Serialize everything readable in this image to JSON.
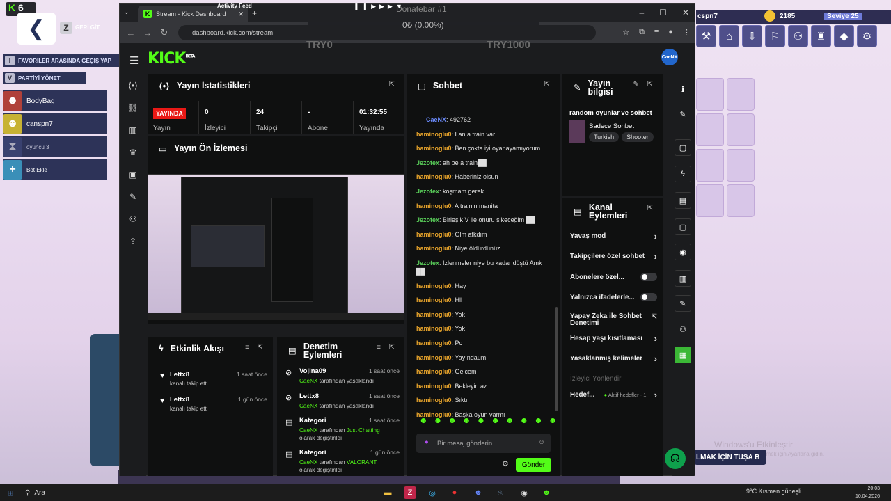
{
  "game": {
    "hud_count": "6",
    "back_label": "GERİ GİT",
    "back_key": "Z",
    "favorites_label": "FAVORİLER ARASINDA GEÇİŞ YAP",
    "favorites_key": "I",
    "party_label": "PARTİYİ YÖNET",
    "party_key": "V",
    "players": [
      {
        "name": "BodyBag"
      },
      {
        "name": "canspn7"
      },
      {
        "name": "oyuncu 3"
      },
      {
        "name": "Bot Ekle"
      }
    ],
    "right_player": "cspn7",
    "coins": "2185",
    "level_label": "Seviye 25",
    "windows_activate": "Windows'u Etkinleştir",
    "windows_activate_sub": "Windows'u etkinleştirmek için Ayarlar'a gidin.",
    "press_key": "LMAK İÇİN TUŞA B"
  },
  "browser": {
    "tab_title": "Stream - Kick Dashboard",
    "url": "dashboard.kick.com/stream",
    "activity_feed_overlay": "Activity Feed",
    "donate_title": "Donatebar #1",
    "donate_value": "0₺ (0.00%)",
    "donate_min": "TRY0",
    "donate_max": "TRY1000"
  },
  "kick": {
    "logo": "KICK",
    "logo_sup": "BETA",
    "user_initials": "CaeNX"
  },
  "stats": {
    "title": "Yayın İstatistikleri",
    "live_badge": "YAYINDA",
    "live_label": "Yayın",
    "viewers_value": "0",
    "viewers_label": "İzleyici",
    "followers_value": "24",
    "followers_label": "Takipçi",
    "subs_value": "-",
    "subs_label": "Abone",
    "uptime_value": "01:32:55",
    "uptime_label": "Yayında"
  },
  "preview": {
    "title": "Yayın Ön İzlemesi"
  },
  "chat": {
    "title": "Sohbet",
    "messages": [
      {
        "user": "CaeNX",
        "text": "492762"
      },
      {
        "user": "haminoglu0",
        "text": "Lan a train var"
      },
      {
        "user": "haminoglu0",
        "text": "Ben çokta iyi oyanayamıyorum"
      },
      {
        "user": "Jezotex",
        "text": "ah be a train██"
      },
      {
        "user": "haminoglu0",
        "text": "Haberiniz olsun"
      },
      {
        "user": "Jezotex",
        "text": "koşmam gerek"
      },
      {
        "user": "haminoglu0",
        "text": "A trainin manita"
      },
      {
        "user": "Jezotex",
        "text": "Birleşik V ile onuru sikeceğim ██"
      },
      {
        "user": "haminoglu0",
        "text": "Olm afkdım"
      },
      {
        "user": "haminoglu0",
        "text": "Niye öldürdünüz"
      },
      {
        "user": "Jezotex",
        "text": "İzlenmeler niye bu kadar düştü Amk ██"
      },
      {
        "user": "haminoglu0",
        "text": "Hay"
      },
      {
        "user": "haminoglu0",
        "text": "Hll"
      },
      {
        "user": "haminoglu0",
        "text": "Yok"
      },
      {
        "user": "haminoglu0",
        "text": "Yok"
      },
      {
        "user": "haminoglu0",
        "text": "Pc"
      },
      {
        "user": "haminoglu0",
        "text": "Yayındaum"
      },
      {
        "user": "haminoglu0",
        "text": "Gelcem"
      },
      {
        "user": "haminoglu0",
        "text": "Bekleyin az"
      },
      {
        "user": "haminoglu0",
        "text": "Sıktı"
      },
      {
        "user": "haminoglu0",
        "text": "Başka oyun varmı"
      }
    ],
    "input_placeholder": "Bir mesaj gönderin",
    "send_label": "Gönder"
  },
  "stream_info": {
    "title": "Yayın bilgisi",
    "stream_title": "random oyunlar ve sohbet",
    "category": "Sadece Sohbet",
    "tags": [
      "Turkish",
      "Shooter"
    ]
  },
  "channel_actions": {
    "title": "Kanal Eylemleri",
    "items": [
      {
        "label": "Yavaş mod"
      },
      {
        "label": "Takipçilere özel sohbet"
      },
      {
        "label": "Abonelere özel..."
      },
      {
        "label": "Yalnızca ifadelerle..."
      },
      {
        "label": "Yapay Zeka ile Sohbet Denetimi"
      },
      {
        "label": "Hesap yaşı kısıtlaması"
      },
      {
        "label": "Yasaklanmış kelimeler"
      },
      {
        "label": "İzleyici Yönlendir"
      },
      {
        "label": "Hedef..."
      }
    ],
    "goal_status": "Aktif hedefler - 1"
  },
  "activity": {
    "title": "Etkinlik Akışı",
    "events": [
      {
        "user": "Lettx8",
        "text": "kanalı takip etti",
        "time": "1 saat önce"
      },
      {
        "user": "Lettx8",
        "text": "kanalı takip etti",
        "time": "1 gün önce"
      }
    ]
  },
  "moderation": {
    "title": "Denetim Eylemleri",
    "events": [
      {
        "user": "Vojina09",
        "actor": "CaeNX",
        "text": "tarafından yasaklandı",
        "time": "1 saat önce"
      },
      {
        "user": "Lettx8",
        "actor": "CaeNX",
        "text": "tarafından yasaklandı",
        "time": "1 saat önce"
      },
      {
        "user": "Kategori",
        "actor": "CaeNX",
        "text": "tarafından",
        "value": "Just Chatting",
        "suffix": "olarak değiştirildi",
        "time": "1 saat önce"
      },
      {
        "user": "Kategori",
        "actor": "CaeNX",
        "text": "tarafından",
        "value": "VALORANT",
        "suffix": "olarak değiştirildi",
        "time": "1 gün önce"
      }
    ]
  },
  "taskbar": {
    "search_label": "Ara",
    "weather": "9°C  Kısmen güneşli",
    "time": "20:03",
    "date": "10.04.2026"
  },
  "colors": {
    "kick_green": "#53fc18",
    "live_red": "#e91916",
    "panel_bg": "#0f1010"
  }
}
